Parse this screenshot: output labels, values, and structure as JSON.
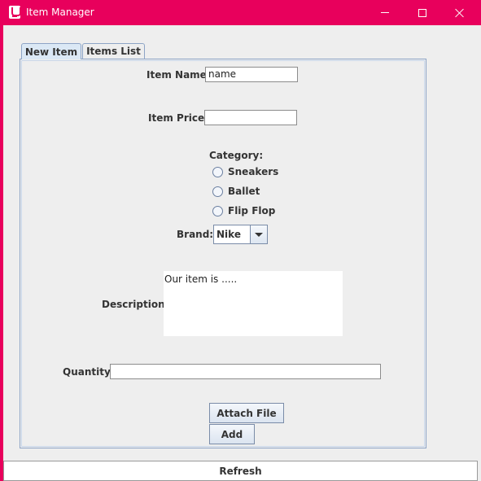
{
  "window": {
    "title": "Item Manager",
    "frame_color": "#e8005c",
    "icons": [
      "java-icon",
      "minimize-icon",
      "maximize-icon",
      "close-icon"
    ]
  },
  "tabs": [
    {
      "label": "New Item",
      "selected": true
    },
    {
      "label": "Items List",
      "selected": false
    }
  ],
  "form": {
    "item_name_label": "Item Name:",
    "item_name_value": "name",
    "item_price_label": "Item Price:",
    "item_price_value": "",
    "category_label": "Category:",
    "categories": [
      {
        "label": "Sneakers",
        "checked": false
      },
      {
        "label": "Ballet",
        "checked": false
      },
      {
        "label": "Flip Flop",
        "checked": false
      }
    ],
    "brand_label": "Brand:",
    "brand_value": "Nike",
    "description_label": "Description:",
    "description_value": "Our item is .....",
    "quantity_label": "Quantity:",
    "quantity_value": "",
    "attach_button": "Attach File",
    "add_button": "Add"
  },
  "refresh_button": "Refresh"
}
